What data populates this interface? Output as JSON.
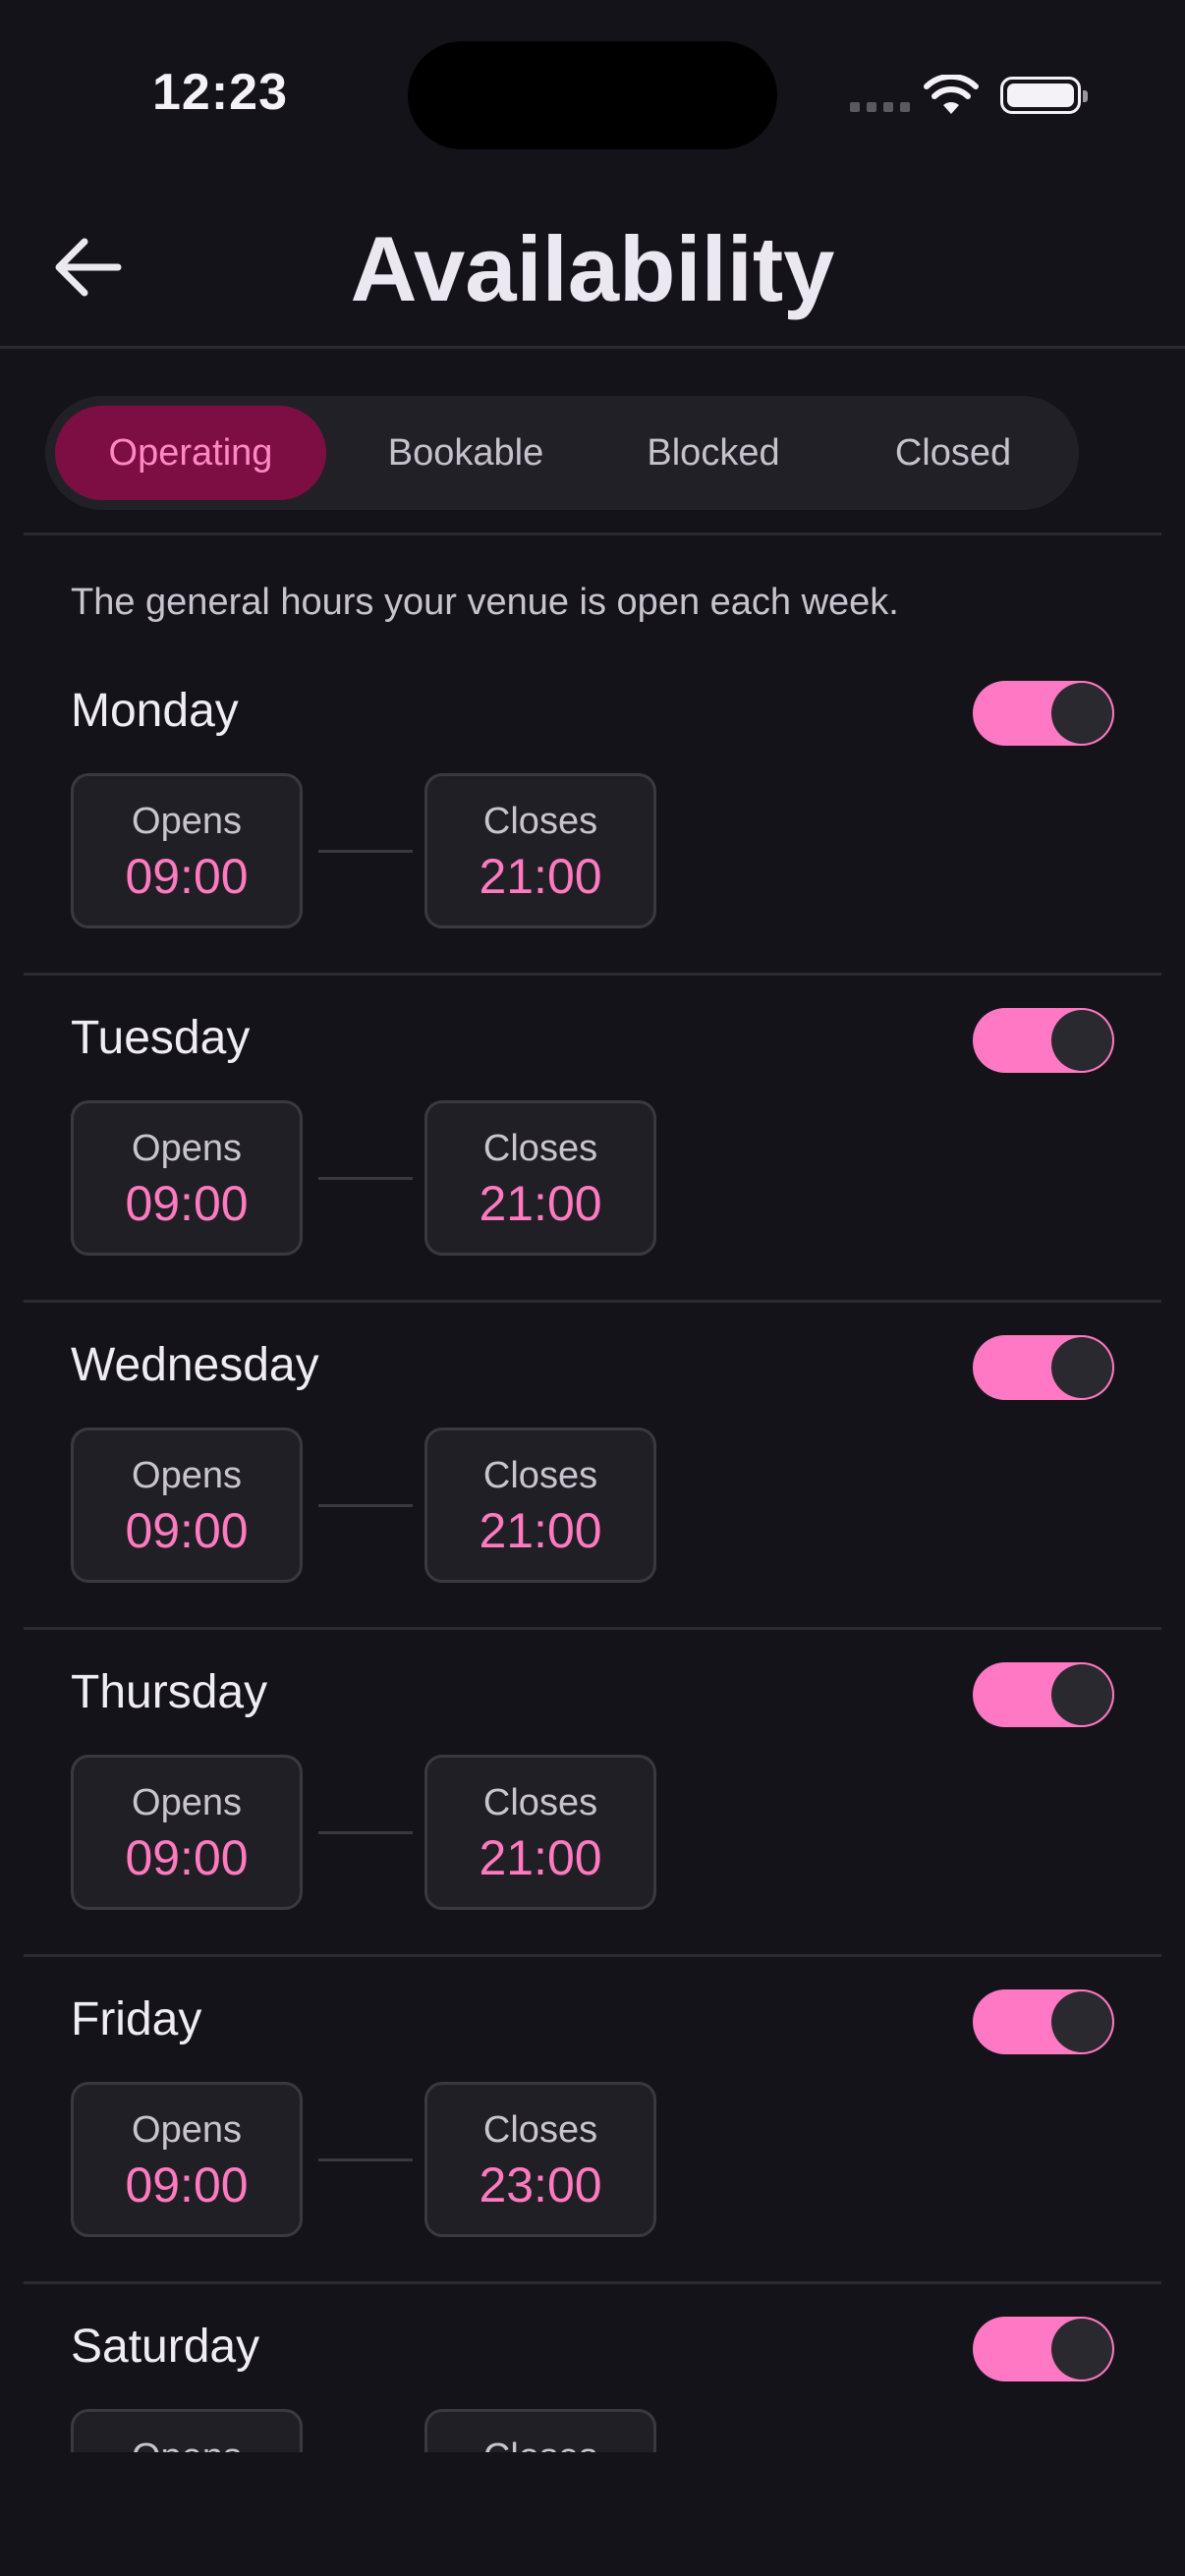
{
  "status_bar": {
    "time": "12:23"
  },
  "header": {
    "title": "Availability"
  },
  "tabs": [
    {
      "label": "Operating",
      "active": true
    },
    {
      "label": "Bookable",
      "active": false
    },
    {
      "label": "Blocked",
      "active": false
    },
    {
      "label": "Closed",
      "active": false
    }
  ],
  "description": "The general hours your venue is open each week.",
  "days": [
    {
      "name": "Monday",
      "enabled": true,
      "opens_label": "Opens",
      "opens": "09:00",
      "closes_label": "Closes",
      "closes": "21:00"
    },
    {
      "name": "Tuesday",
      "enabled": true,
      "opens_label": "Opens",
      "opens": "09:00",
      "closes_label": "Closes",
      "closes": "21:00"
    },
    {
      "name": "Wednesday",
      "enabled": true,
      "opens_label": "Opens",
      "opens": "09:00",
      "closes_label": "Closes",
      "closes": "21:00"
    },
    {
      "name": "Thursday",
      "enabled": true,
      "opens_label": "Opens",
      "opens": "09:00",
      "closes_label": "Closes",
      "closes": "21:00"
    },
    {
      "name": "Friday",
      "enabled": true,
      "opens_label": "Opens",
      "opens": "09:00",
      "closes_label": "Closes",
      "closes": "23:00"
    },
    {
      "name": "Saturday",
      "enabled": true,
      "opens_label": "Opens",
      "opens": "",
      "closes_label": "Closes",
      "closes": ""
    }
  ],
  "colors": {
    "accent": "#ff78c4",
    "active_tab_bg": "#7d0e43",
    "background": "#15131a"
  },
  "icons": {
    "back": "arrow-left-icon",
    "wifi": "wifi-icon",
    "battery": "battery-icon",
    "signal": "cellular-signal-icon"
  }
}
